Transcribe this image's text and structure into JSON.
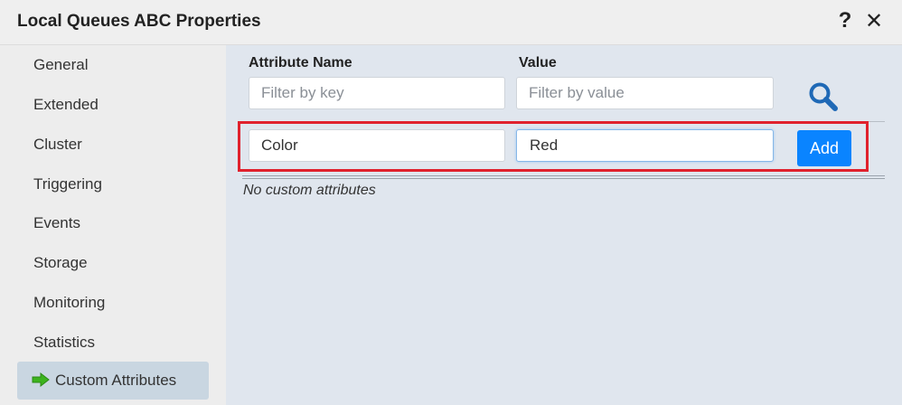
{
  "window": {
    "title": "Local Queues ABC Properties",
    "help_glyph": "?",
    "close_glyph": "✕"
  },
  "sidebar": {
    "items": [
      {
        "label": "General"
      },
      {
        "label": "Extended"
      },
      {
        "label": "Cluster"
      },
      {
        "label": "Triggering"
      },
      {
        "label": "Events"
      },
      {
        "label": "Storage"
      },
      {
        "label": "Monitoring"
      },
      {
        "label": "Statistics"
      },
      {
        "label": "Custom Attributes",
        "active": true
      }
    ]
  },
  "filters": {
    "name_label": "Attribute Name",
    "value_label": "Value",
    "key_placeholder": "Filter by key",
    "value_placeholder": "Filter by value"
  },
  "new_attribute": {
    "name": "Color",
    "value": "Red",
    "add_label": "Add"
  },
  "attributes": {
    "empty_message": "No custom attributes"
  },
  "colors": {
    "accent": "#0a84ff",
    "highlight": "#e0212d",
    "active_arrow": "#3cb31e"
  }
}
